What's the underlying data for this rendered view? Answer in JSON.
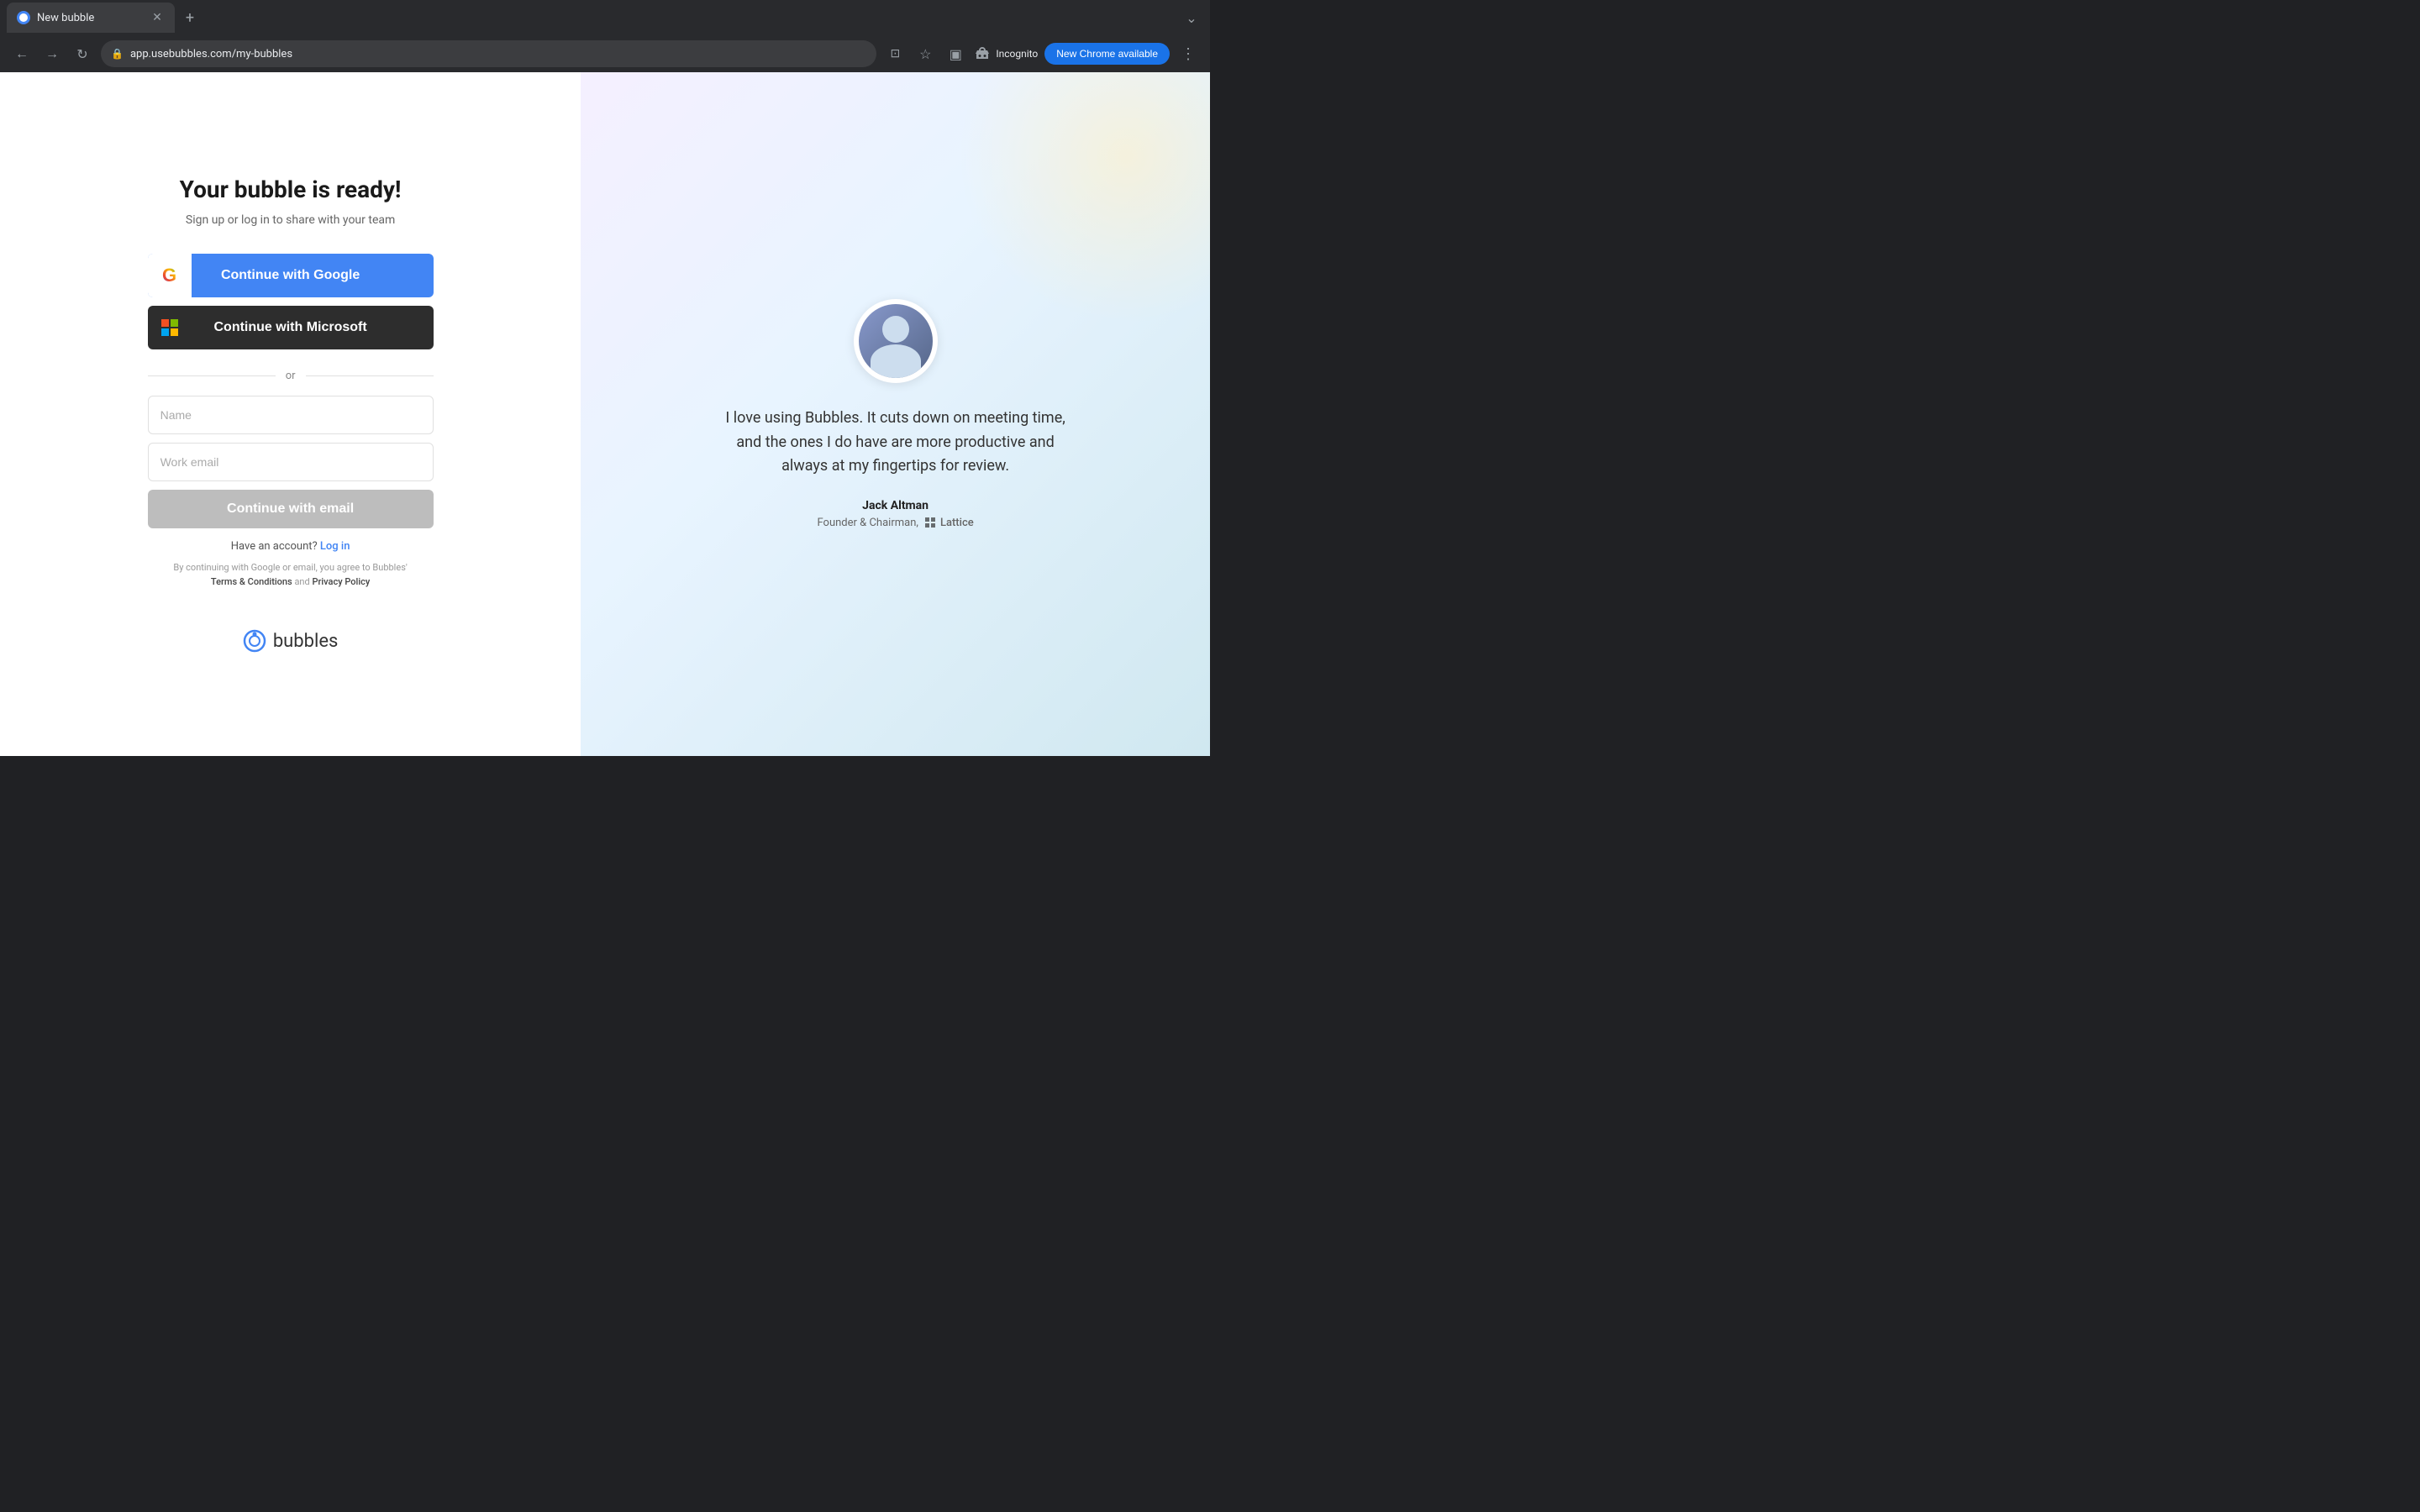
{
  "browser": {
    "tab_title": "New bubble",
    "new_tab_tooltip": "New tab",
    "address": "app.usebubbles.com/my-bubbles",
    "incognito_label": "Incognito",
    "new_chrome_label": "New Chrome available"
  },
  "signup": {
    "title": "Your bubble is ready!",
    "subtitle": "Sign up or log in to share with your team",
    "google_btn": "Continue with Google",
    "microsoft_btn": "Continue with Microsoft",
    "or_label": "or",
    "name_placeholder": "Name",
    "email_placeholder": "Work email",
    "continue_email_btn": "Continue with email",
    "have_account_text": "Have an account?",
    "login_link": "Log in",
    "terms_text": "By continuing with Google or email, you agree to Bubbles'",
    "terms_link": "Terms & Conditions",
    "and_text": "and",
    "privacy_link": "Privacy Policy"
  },
  "testimonial": {
    "quote": "I love using Bubbles. It cuts down on meeting time, and the ones I do have are more productive and always at my fingertips for review.",
    "author": "Jack Altman",
    "role": "Founder & Chairman,",
    "company": "Lattice"
  },
  "logo": {
    "text": "bubbles"
  }
}
